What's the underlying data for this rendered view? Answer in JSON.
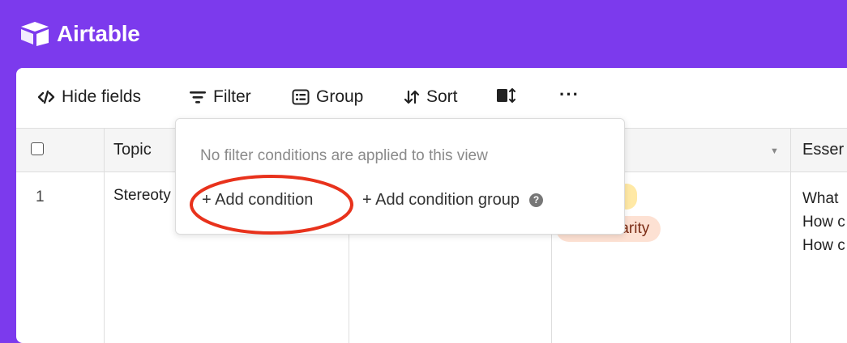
{
  "app": {
    "name": "Airtable",
    "logo_icon": "airtable-logo-icon",
    "header_color": "#7c3aed"
  },
  "toolbar": {
    "hide_fields": "Hide fields",
    "filter": "Filter",
    "group": "Group",
    "sort": "Sort",
    "more": "···"
  },
  "grid": {
    "columns": [
      {
        "label": "Topic"
      },
      {
        "label": "Esser"
      }
    ],
    "rows": [
      {
        "number": "1",
        "topic": "Stereoty",
        "tag": "m/Solidarity",
        "essential_lines": [
          "What",
          "How c",
          "How c"
        ]
      }
    ]
  },
  "filter_popover": {
    "message": "No filter conditions are applied to this view",
    "add_condition": "+ Add condition",
    "add_condition_group": "+ Add condition group",
    "help": "?"
  },
  "annotation": {
    "type": "red-circle",
    "color": "#e8321c",
    "target": "add-condition-button"
  }
}
